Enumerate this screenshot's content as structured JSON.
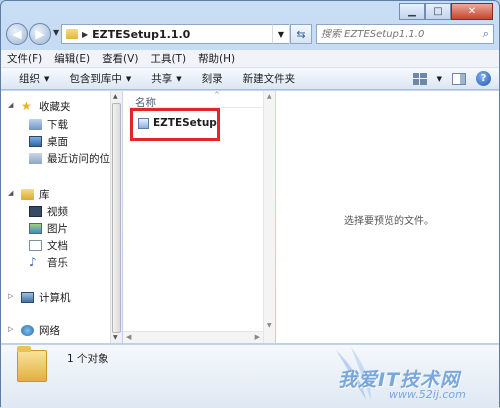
{
  "address": {
    "path": "EZTESetup1.1.0"
  },
  "search": {
    "placeholder": "搜索 EZTESetup1.1.0"
  },
  "menu": [
    "文件(F)",
    "编辑(E)",
    "查看(V)",
    "工具(T)",
    "帮助(H)"
  ],
  "toolbar": {
    "organize": "组织",
    "include": "包含到库中",
    "share": "共享",
    "burn": "刻录",
    "new_folder": "新建文件夹"
  },
  "nav": {
    "favorites": "收藏夹",
    "downloads": "下载",
    "desktop": "桌面",
    "recent": "最近访问的位置",
    "libraries": "库",
    "videos": "视频",
    "pictures": "图片",
    "documents": "文档",
    "music": "音乐",
    "computer": "计算机",
    "network": "网络"
  },
  "file_list": {
    "column_name": "名称",
    "items": [
      {
        "name": "EZTESetup"
      }
    ]
  },
  "preview": {
    "message": "选择要预览的文件。"
  },
  "status": {
    "count": "1 个对象"
  },
  "watermark": {
    "text": "我爱IT技术网",
    "url": "www.52ij.com"
  },
  "colors": {
    "highlight": "#e0262a",
    "window_frame": "#b9d1ea"
  }
}
